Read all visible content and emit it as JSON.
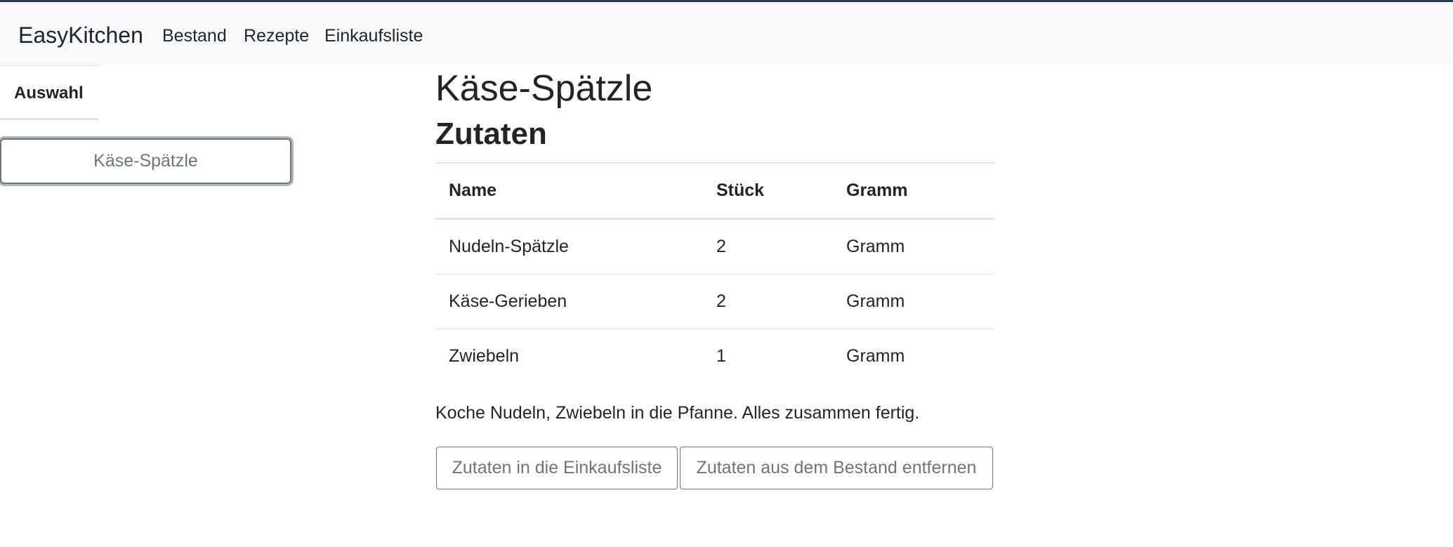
{
  "navbar": {
    "brand": "EasyKitchen",
    "links": [
      "Bestand",
      "Rezepte",
      "Einkaufsliste"
    ]
  },
  "sidebar": {
    "tab_label": "Auswahl",
    "recipes": [
      "Käse-Spätzle"
    ]
  },
  "recipe": {
    "title": "Käse-Spätzle",
    "ingredients_heading": "Zutaten",
    "table": {
      "headers": [
        "Name",
        "Stück",
        "Gramm"
      ],
      "rows": [
        [
          "Nudeln-Spätzle",
          "2",
          "Gramm"
        ],
        [
          "Käse-Gerieben",
          "2",
          "Gramm"
        ],
        [
          "Zwiebeln",
          "1",
          "Gramm"
        ]
      ]
    },
    "instructions": "Koche Nudeln, Zwiebeln in die Pfanne. Alles zusammen fertig.",
    "buttons": {
      "add_to_shopping_list": "Zutaten in die Einkaufsliste",
      "remove_from_stock": "Zutaten aus dem Bestand entfernen"
    }
  },
  "colors": {
    "navbar_bg": "#f8f9fa",
    "top_border": "#2b3a55",
    "button_secondary": "#6c757d",
    "table_border": "#dee2e6"
  }
}
